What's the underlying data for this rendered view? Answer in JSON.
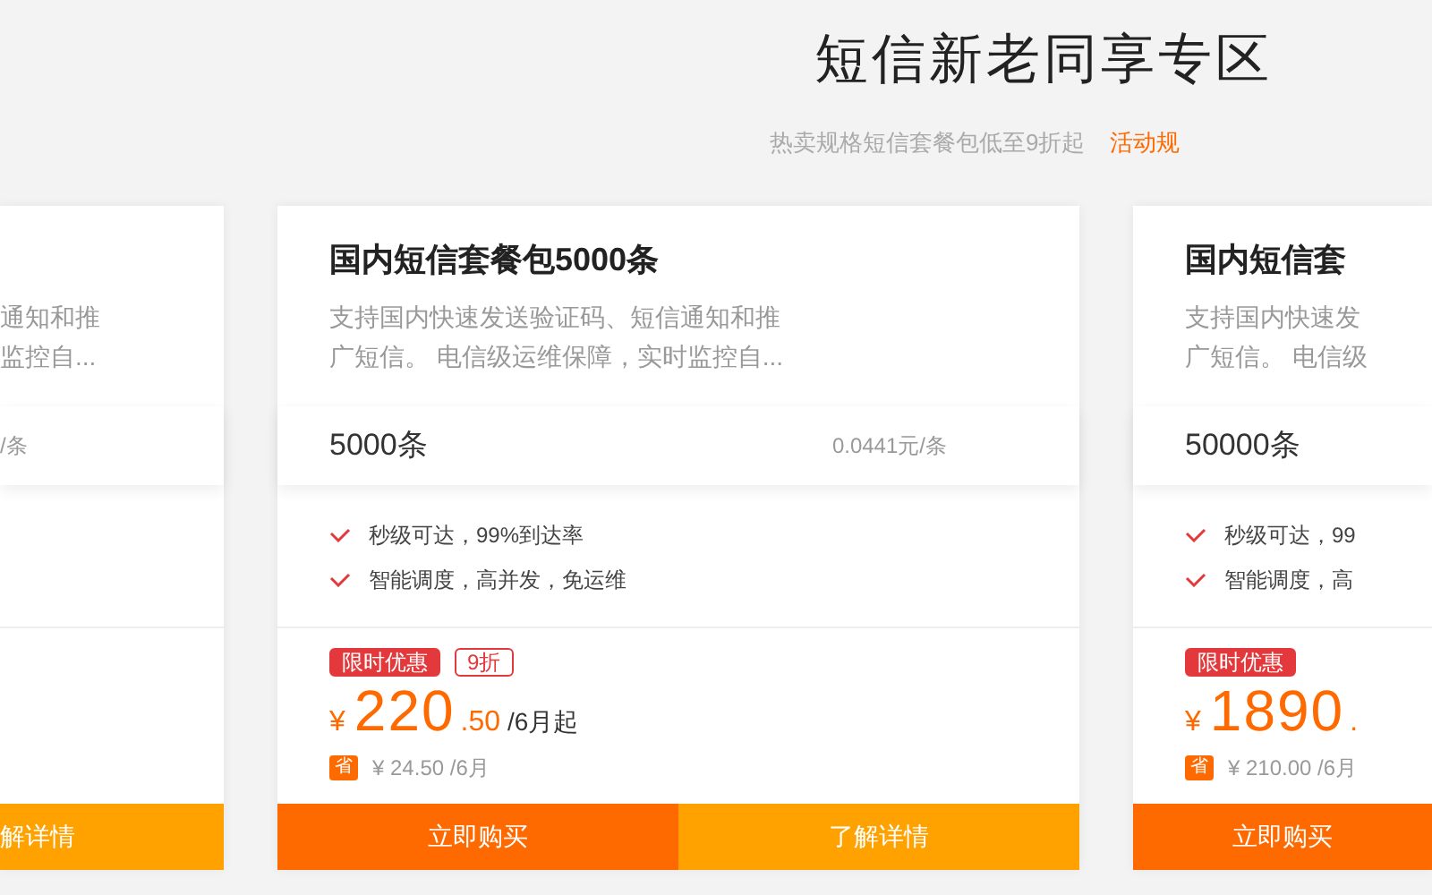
{
  "header": {
    "title": "短信新老同享专区",
    "subtitle": "热卖规格短信套餐包低至9折起",
    "rules_link": "活动规"
  },
  "cards": [
    {
      "kind": "clipped-left",
      "description_lines": [
        "通知和推",
        "监控自..."
      ],
      "spec_price": "/条",
      "buttons": [
        {
          "label": "解详情",
          "kind": "details"
        }
      ]
    },
    {
      "kind": "full",
      "title": "国内短信套餐包5000条",
      "description_lines": [
        "支持国内快速发送验证码、短信通知和推",
        "广短信。 电信级运维保障，实时监控自..."
      ],
      "spec": "5000条",
      "spec_price": "0.0441元/条",
      "features": [
        "秒级可达，99%到达率",
        "智能调度，高并发，免运维"
      ],
      "tags": [
        {
          "label": "限时优惠",
          "kind": "promo"
        },
        {
          "label": "9折",
          "kind": "discount"
        }
      ],
      "price": {
        "currency": "¥",
        "integer": "220",
        "decimal": ".50",
        "unit": "/6月起"
      },
      "saving": {
        "badge": "省",
        "text": "¥ 24.50 /6月"
      },
      "buttons": [
        {
          "label": "立即购买",
          "kind": "buy"
        },
        {
          "label": "了解详情",
          "kind": "details"
        }
      ]
    },
    {
      "kind": "clipped-right",
      "title": "国内短信套",
      "description_lines": [
        "支持国内快速发",
        "广短信。 电信级"
      ],
      "spec": "50000条",
      "features": [
        "秒级可达，99",
        "智能调度，高"
      ],
      "tags": [
        {
          "label": "限时优惠",
          "kind": "promo"
        }
      ],
      "price": {
        "currency": "¥",
        "integer": "1890",
        "decimal": "."
      },
      "saving": {
        "badge": "省",
        "text": "¥ 210.00 /6月"
      },
      "buttons": [
        {
          "label": "立即购买",
          "kind": "buy"
        }
      ]
    }
  ]
}
